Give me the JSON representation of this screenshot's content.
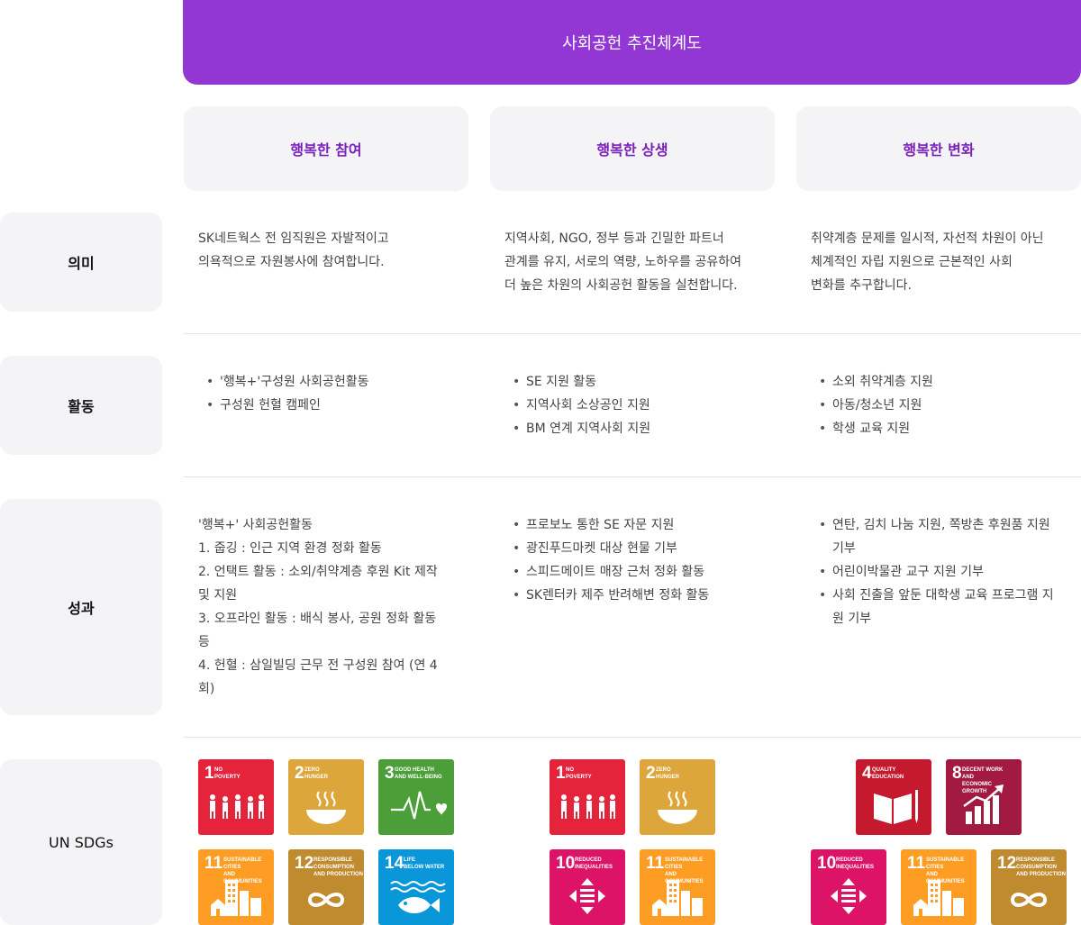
{
  "title": "사회공헌 추진체계도",
  "columns": [
    "행복한 참여",
    "행복한 상생",
    "행복한 변화"
  ],
  "rows": {
    "meaning": {
      "label": "의미",
      "cells": [
        [
          "SK네트웍스 전 임직원은 자발적이고",
          "의욕적으로 자원봉사에 참여합니다."
        ],
        [
          "지역사회, NGO, 정부 등과 긴밀한 파트너",
          "관계를 유지, 서로의 역량, 노하우를 공유하여",
          "더 높은 차원의 사회공헌 활동을 실천합니다."
        ],
        [
          "취약계층 문제를 일시적, 자선적 차원이 아닌",
          "체계적인 자립 지원으로 근본적인 사회",
          "변화를 추구합니다."
        ]
      ]
    },
    "activity": {
      "label": "활동",
      "cells": [
        [
          "'행복+'구성원 사회공헌활동",
          "구성원 헌혈 캠페인"
        ],
        [
          "SE 지원 활동",
          "지역사회 소상공인 지원",
          "BM 연계 지역사회 지원"
        ],
        [
          "소외 취약계층 지원",
          "아동/청소년 지원",
          "학생 교육 지원"
        ]
      ]
    },
    "results": {
      "label": "성과",
      "col1_lines": [
        "'행복+' 사회공헌활동",
        "1. 줍깅 : 인근 지역 환경 정화 활동",
        "2. 언택트 활동 : 소외/취약계층 후원 Kit 제작",
        "및 지원",
        "3. 오프라인 활동 : 배식 봉사, 공원 정화 활동",
        "등",
        "4. 헌혈 : 삼일빌딩 근무 전 구성원 참여 (연 4",
        "회)"
      ],
      "col2_items": [
        "프로보노 통한 SE 자문 지원",
        "광진푸드마켓 대상 현물 기부",
        "스피드메이트 매장 근처 정화 활동",
        "SK렌터카 제주 반려해변 정화 활동"
      ],
      "col3_items": [
        [
          "연탄, 김치 나눔 지원, 쪽방촌 후원품 지원",
          "기부"
        ],
        [
          "어린이박물관 교구 지원 기부"
        ],
        [
          "사회 진출을 앞둔 대학생 교육 프로그램 지",
          "원 기부"
        ]
      ]
    },
    "sdgs": {
      "label": "UN SDGs"
    }
  },
  "sdg_cards": {
    "g1": {
      "num": "1",
      "line1": "NO",
      "line2": "POVERTY",
      "color": "#e5243b"
    },
    "g2": {
      "num": "2",
      "line1": "ZERO",
      "line2": "HUNGER",
      "color": "#dda63a"
    },
    "g3": {
      "num": "3",
      "line1": "GOOD HEALTH",
      "line2": "AND WELL-BEING",
      "color": "#4c9f38"
    },
    "g4": {
      "num": "4",
      "line1": "QUALITY",
      "line2": "EDUCATION",
      "color": "#c5192d"
    },
    "g8": {
      "num": "8",
      "line1": "DECENT WORK AND",
      "line2": "ECONOMIC GROWTH",
      "color": "#a21942"
    },
    "g10": {
      "num": "10",
      "line1": "REDUCED",
      "line2": "INEQUALITIES",
      "color": "#dd1367"
    },
    "g11": {
      "num": "11",
      "line1": "SUSTAINABLE CITIES",
      "line2": "AND COMMUNITIES",
      "color": "#fd9d24"
    },
    "g12": {
      "num": "12",
      "line1": "RESPONSIBLE",
      "line2": "CONSUMPTION",
      "line3": "AND PRODUCTION",
      "color": "#bf8b2e"
    },
    "g14": {
      "num": "14",
      "line1": "LIFE",
      "line2": "BELOW WATER",
      "color": "#0a97d9"
    }
  }
}
